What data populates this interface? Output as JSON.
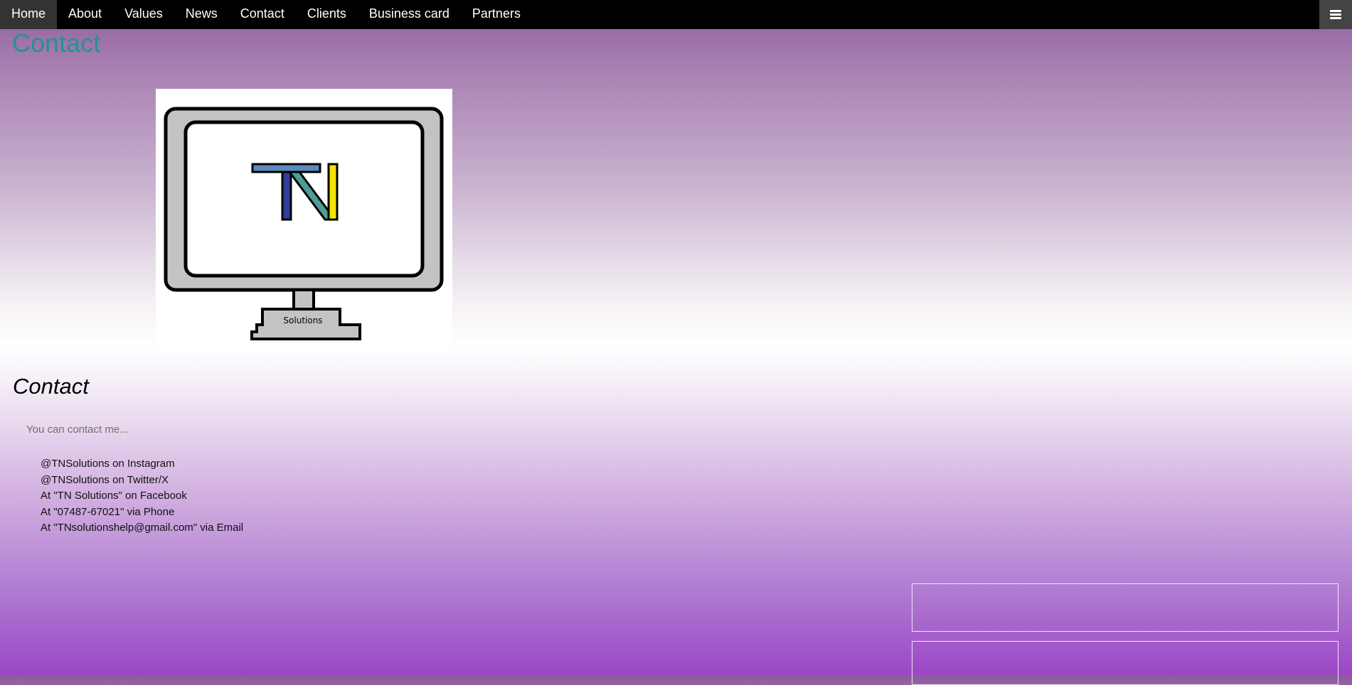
{
  "nav": {
    "items": [
      {
        "label": "Home",
        "active": true
      },
      {
        "label": "About"
      },
      {
        "label": "Values"
      },
      {
        "label": "News"
      },
      {
        "label": "Contact"
      },
      {
        "label": "Clients"
      },
      {
        "label": "Business card"
      },
      {
        "label": "Partners"
      }
    ],
    "menu_icon": "hamburger-menu-icon"
  },
  "page_title": "Contact",
  "logo": {
    "letters": "TN",
    "caption": "Solutions"
  },
  "section": {
    "heading": "Contact",
    "intro": "You can contact me...",
    "contacts": [
      "@TNSolutions on Instagram",
      "@TNSolutions on Twitter/X",
      "At \"TN Solutions\" on Facebook",
      "At \"07487-67021\" via Phone",
      "At \"TNsolutionshelp@gmail.com\" via Email"
    ]
  },
  "colors": {
    "nav_bg": "#000000",
    "title": "#20958f",
    "logo_t": "#5b8bbf",
    "logo_n_left": "#2f3e98",
    "logo_n_right": "#f5e400"
  }
}
